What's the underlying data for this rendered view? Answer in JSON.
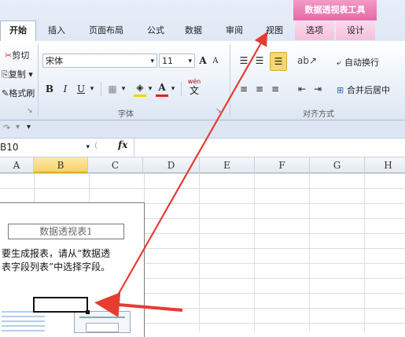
{
  "ribbon_tabs": {
    "context_header": "数据透视表工具",
    "tabs": [
      "开始",
      "插入",
      "页面布局",
      "公式",
      "数据",
      "审阅",
      "视图"
    ],
    "context_tabs": [
      "选项",
      "设计"
    ]
  },
  "clipboard": {
    "cut": "剪切",
    "copy": "复制 ▾",
    "format_painter": "格式刷"
  },
  "font": {
    "name": "宋体",
    "size": "11",
    "grow": "A",
    "shrink": "A",
    "bold": "B",
    "italic": "I",
    "underline": "U",
    "phonetic": "wén",
    "group_label": "字体"
  },
  "alignment": {
    "wrap_text": "自动换行",
    "merge_center": "合并后居中",
    "group_label": "对齐方式"
  },
  "quick_access": "▾",
  "formula_bar": {
    "name_box": "B10",
    "fx": "fx",
    "content": ""
  },
  "columns": [
    "A",
    "B",
    "C",
    "D",
    "E",
    "F",
    "G",
    "H"
  ],
  "pivot": {
    "title": "数据透视表1",
    "message_line1": "要生成报表，请从“数据透",
    "message_line2": "表字段列表”中选择字段。"
  },
  "colors": {
    "accent_arrow": "#e63c32",
    "selected_column": "#f7d266",
    "context_tab": "#e46aa6"
  }
}
